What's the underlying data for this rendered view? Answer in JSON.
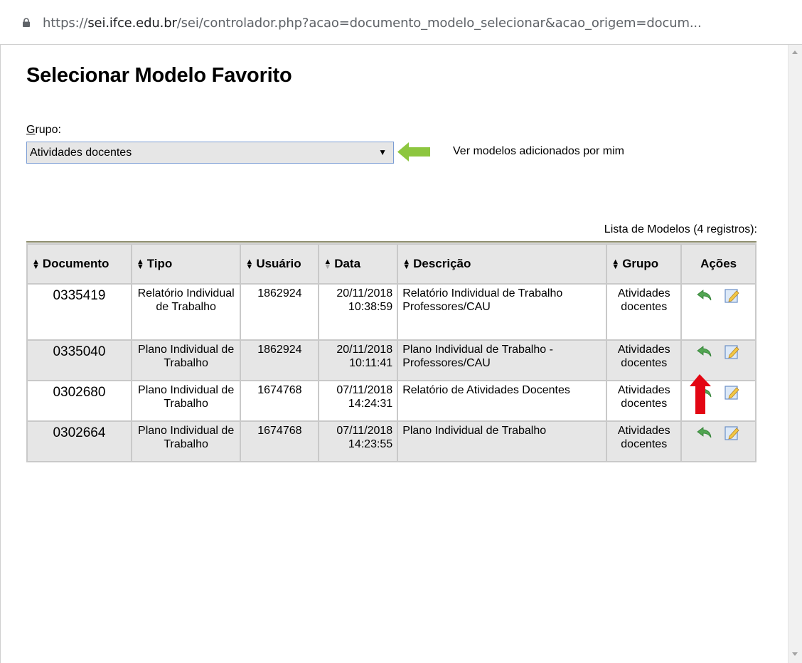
{
  "browser": {
    "url_prefix": "https://",
    "url_domain": "sei.ifce.edu.br",
    "url_rest": "/sei/controlador.php?acao=documento_modelo_selecionar&acao_origem=docum..."
  },
  "page": {
    "title": "Selecionar Modelo Favorito"
  },
  "filter": {
    "grupo_label_first": "G",
    "grupo_label_rest": "rupo:",
    "selected": "Atividades docentes",
    "caret": "▼",
    "ver_modelos_link": "Ver modelos adicionados por mim"
  },
  "table": {
    "caption": "Lista de Modelos (4 registros):",
    "headers": [
      "Documento",
      "Tipo",
      "Usuário",
      "Data",
      "Descrição",
      "Grupo",
      "Ações"
    ],
    "rows": [
      {
        "documento": "0335419",
        "tipo": "Relatório Individual de Trabalho",
        "usuario": "1862924",
        "data": "20/11/2018",
        "hora": "10:38:59",
        "descricao": "Relatório Individual de Trabalho Professores/CAU",
        "grupo": "Atividades docentes"
      },
      {
        "documento": "0335040",
        "tipo": "Plano Individual de Trabalho",
        "usuario": "1862924",
        "data": "20/11/2018",
        "hora": "10:11:41",
        "descricao": "Plano Individual de Trabalho - Professores/CAU",
        "grupo": "Atividades docentes"
      },
      {
        "documento": "0302680",
        "tipo": "Plano Individual de Trabalho",
        "usuario": "1674768",
        "data": "07/11/2018",
        "hora": "14:24:31",
        "descricao": "Relatório de Atividades Docentes",
        "grupo": "Atividades docentes"
      },
      {
        "documento": "0302664",
        "tipo": "Plano Individual de Trabalho",
        "usuario": "1674768",
        "data": "07/11/2018",
        "hora": "14:23:55",
        "descricao": "Plano Individual de Trabalho",
        "grupo": "Atividades docentes"
      }
    ]
  },
  "icons": {
    "lock": "lock-icon",
    "select_model": "green-return-arrow-icon",
    "edit": "edit-note-icon",
    "highlight_green": "green-arrow-icon",
    "highlight_red": "red-arrow-icon"
  },
  "colors": {
    "green_arrow": "#8dc63f",
    "red_arrow": "#e30613",
    "header_bg": "#e6e6e6"
  }
}
